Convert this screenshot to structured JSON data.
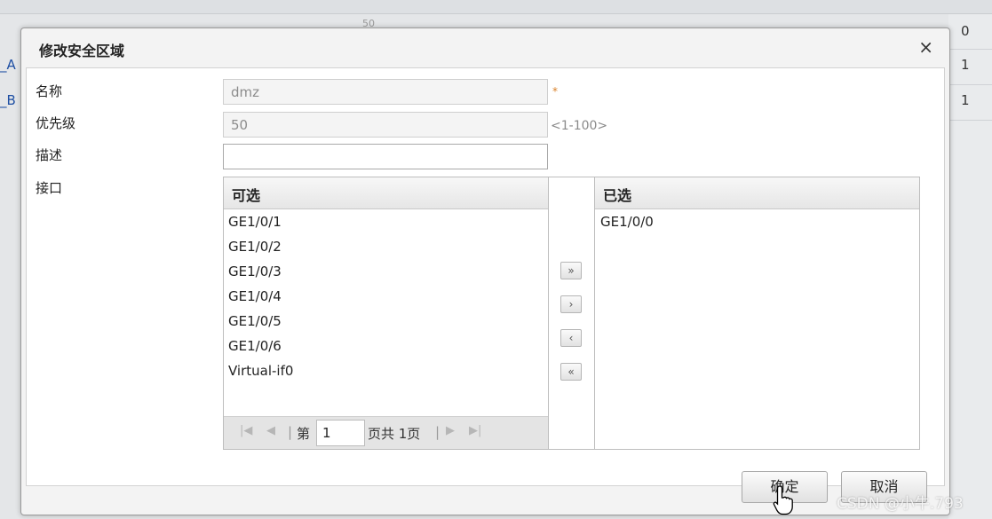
{
  "background": {
    "top_value": "50",
    "right_numbers": [
      "0",
      "1",
      "1"
    ],
    "left_links": [
      "_A",
      "_B"
    ]
  },
  "dialog": {
    "title": "修改安全区域",
    "close_symbol": "×",
    "fields": {
      "name_label": "名称",
      "name_value": "dmz",
      "name_required": "*",
      "priority_label": "优先级",
      "priority_value": "50",
      "priority_hint": "<1-100>",
      "desc_label": "描述",
      "desc_value": "",
      "interface_label": "接口"
    },
    "available": {
      "header": "可选",
      "items": [
        "GE1/0/1",
        "GE1/0/2",
        "GE1/0/3",
        "GE1/0/4",
        "GE1/0/5",
        "GE1/0/6",
        "Virtual-if0"
      ]
    },
    "selected": {
      "header": "已选",
      "items": [
        "GE1/0/0"
      ]
    },
    "move_buttons": {
      "add_all": "»",
      "add": "›",
      "remove": "‹",
      "remove_all": "«"
    },
    "pager": {
      "first_icon": "|◀",
      "prev_icon": "◀",
      "page_prefix": "第",
      "page_value": "1",
      "page_suffix": "页共 1页",
      "next_icon": "▶",
      "last_icon": "▶|"
    },
    "buttons": {
      "ok": "确定",
      "cancel": "取消"
    }
  },
  "watermark": "CSDN @小牛.793",
  "colors": {
    "link": "#1e4fa3",
    "required": "#d9822b",
    "header_bg": "#e6e6e6"
  }
}
